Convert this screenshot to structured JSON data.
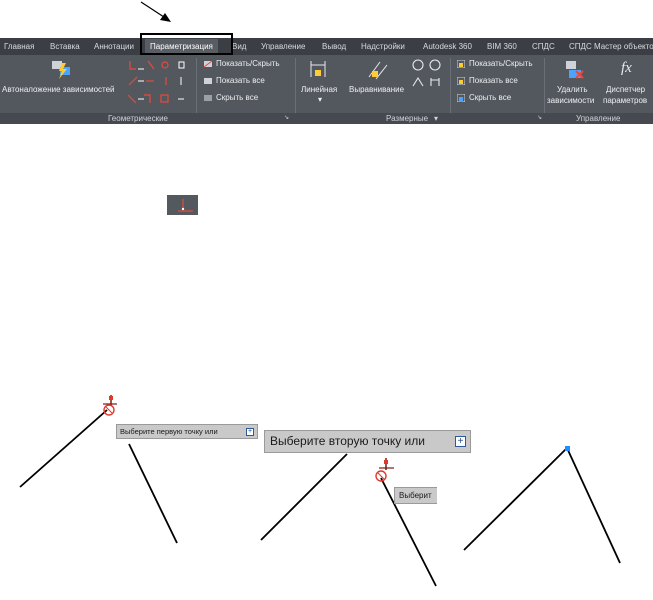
{
  "ribbon": {
    "tabs": [
      {
        "label": "Главная"
      },
      {
        "label": "Вставка"
      },
      {
        "label": "Аннотации"
      },
      {
        "label": "Параметризация",
        "active": true
      },
      {
        "label": "Вид"
      },
      {
        "label": "Управление"
      },
      {
        "label": "Вывод"
      },
      {
        "label": "Надстройки"
      },
      {
        "label": "Autodesk 360"
      },
      {
        "label": "BIM 360"
      },
      {
        "label": "СПДС"
      },
      {
        "label": "СПДС Мастер объектов"
      }
    ],
    "geometric": {
      "panel_label": "Геометрические",
      "auto_constrain_label": "Автоналожение зависимостей",
      "show_hide": "Показать/Скрыть",
      "show_all": "Показать все",
      "hide_all": "Скрыть все"
    },
    "dimensional": {
      "panel_label": "Размерные",
      "panel_arrow": "▾",
      "linear": "Линейная",
      "linear_arrow": "▾",
      "aligned": "Выравнивание",
      "show_hide": "Показать/Скрыть",
      "show_all": "Показать все",
      "hide_all": "Скрыть все"
    },
    "manage": {
      "panel_label": "Управление",
      "delete_line1": "Удалить",
      "delete_line2": "зависимости",
      "params_line1": "Диспетчер",
      "params_line2": "параметров",
      "fx_icon_text": "fx"
    },
    "panel_launcher": "↘"
  },
  "prompts": {
    "first_point": "Выберите первую точку или",
    "second_point": "Выберите вторую точку или",
    "third_partial": "Выберит",
    "expand_symbol": "+"
  },
  "colors": {
    "tab_bar_bg": "#3b3f45",
    "ribbon_bg": "#53575e",
    "active_tab_bg": "#585d64",
    "constraint_marker": "#e0392b",
    "grip_blue": "#1e8fff",
    "highlight_border": "#000000"
  }
}
